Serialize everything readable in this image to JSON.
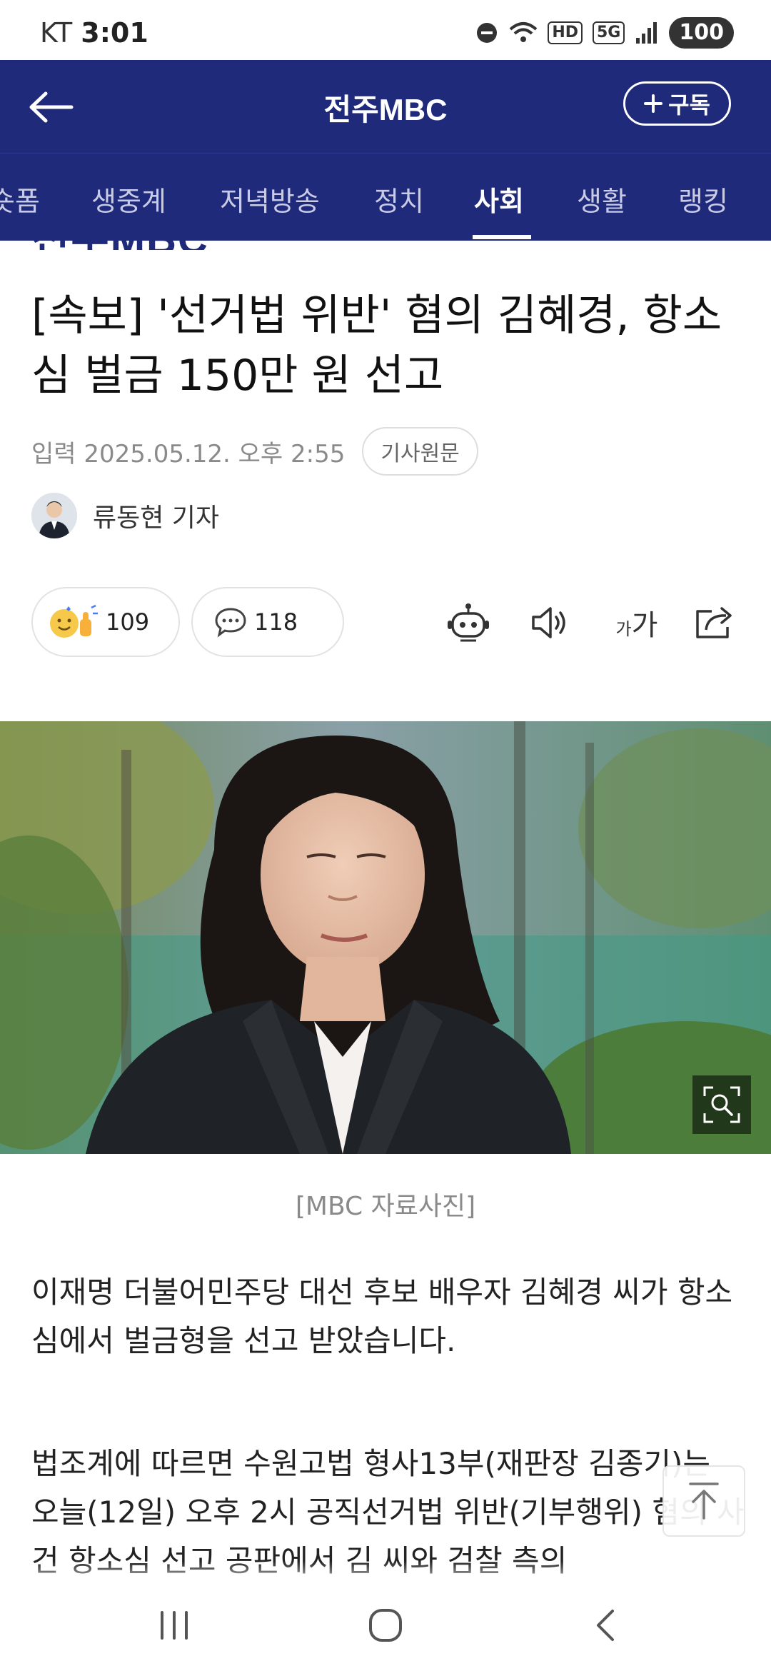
{
  "status_bar": {
    "carrier": "KT",
    "time": "3:01",
    "network": "5G",
    "hd": "HD",
    "battery": "100"
  },
  "header": {
    "brand": "전주MBC",
    "subscribe_label": "구독"
  },
  "tabs": [
    {
      "label": "숏폼",
      "active": false
    },
    {
      "label": "생중계",
      "active": false
    },
    {
      "label": "저녁방송",
      "active": false
    },
    {
      "label": "정치",
      "active": false
    },
    {
      "label": "사회",
      "active": true
    },
    {
      "label": "생활",
      "active": false
    },
    {
      "label": "랭킹",
      "active": false
    }
  ],
  "logo_remnant": "전주MBC",
  "article": {
    "title": "[속보] '선거법 위반' 혐의 김혜경, 항소심 벌금 150만 원 선고",
    "date": "입력 2025.05.12. 오후 2:55",
    "original_label": "기사원문",
    "reporter": "류동현 기자",
    "reaction_count": "109",
    "comment_count": "118",
    "font_size_label_small": "가",
    "font_size_label_large": "가",
    "photo_caption": "[MBC 자료사진]",
    "paragraph1": "이재명 더불어민주당 대선 후보 배우자 김혜경 씨가 항소심에서 벌금형을 선고 받았습니다.",
    "paragraph2": "법조계에 따르면 수원고법 형사13부(재판장 김종기)는 오늘(12일) 오후 2시 공직선거법 위반(기부행위) 혐의 사건 항소심 선고 공판에서 김 씨와 검찰 측의"
  },
  "colors": {
    "header_bg": "#1f2a7a",
    "text": "#111111",
    "muted": "#8a8a8a"
  }
}
